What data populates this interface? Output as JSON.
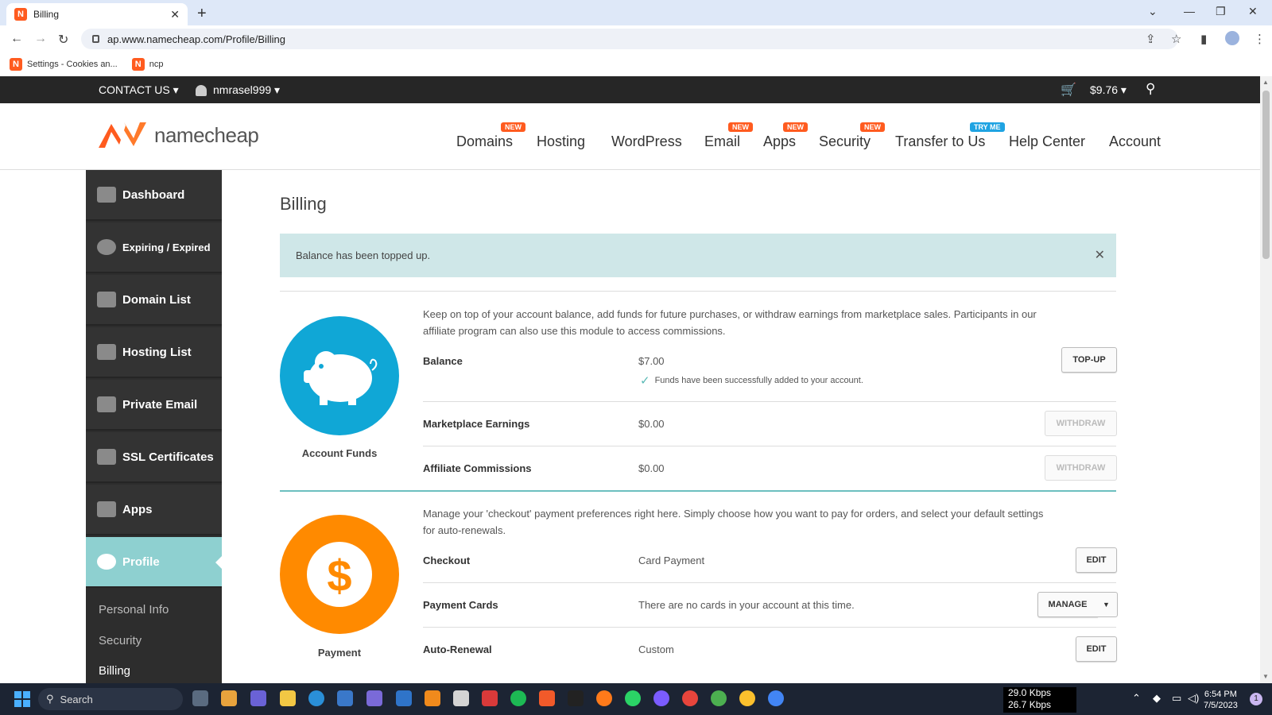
{
  "browser": {
    "tab_title": "Billing",
    "url": "ap.www.namecheap.com/Profile/Billing",
    "bookmarks": [
      {
        "label": "Settings - Cookies an..."
      },
      {
        "label": "ncp"
      }
    ]
  },
  "topbar": {
    "contact": "CONTACT US ▾",
    "username": "nmrasel999 ▾",
    "cart_total": "$9.76 ▾"
  },
  "header": {
    "logo_text": "namecheap",
    "nav": [
      {
        "label": "Domains",
        "badge": "NEW"
      },
      {
        "label": "Hosting",
        "badge": ""
      },
      {
        "label": "WordPress",
        "badge": ""
      },
      {
        "label": "Email",
        "badge": "NEW"
      },
      {
        "label": "Apps",
        "badge": "NEW"
      },
      {
        "label": "Security",
        "badge": "NEW"
      },
      {
        "label": "Transfer to Us",
        "badge": "TRY ME"
      },
      {
        "label": "Help Center",
        "badge": ""
      },
      {
        "label": "Account",
        "badge": ""
      }
    ]
  },
  "sidebar": {
    "items": [
      {
        "label": "Dashboard"
      },
      {
        "label": "Expiring / Expired"
      },
      {
        "label": "Domain List"
      },
      {
        "label": "Hosting List"
      },
      {
        "label": "Private Email"
      },
      {
        "label": "SSL Certificates"
      },
      {
        "label": "Apps"
      },
      {
        "label": "Profile"
      }
    ],
    "sub_items": [
      {
        "label": "Personal Info"
      },
      {
        "label": "Security"
      },
      {
        "label": "Billing"
      }
    ]
  },
  "main": {
    "title": "Billing",
    "alert": "Balance has been topped up.",
    "funds": {
      "label": "Account Funds",
      "intro": "Keep on top of your account balance, add funds for future purchases, or withdraw earnings from marketplace sales. Participants in our affiliate program can also use this module to access commissions.",
      "rows": [
        {
          "label": "Balance",
          "value": "$7.00",
          "note": "Funds have been successfully added to your account.",
          "button": "TOP-UP"
        },
        {
          "label": "Marketplace Earnings",
          "value": "$0.00",
          "button": "WITHDRAW"
        },
        {
          "label": "Affiliate Commissions",
          "value": "$0.00",
          "button": "WITHDRAW"
        }
      ]
    },
    "payment": {
      "label": "Payment",
      "intro": "Manage your 'checkout' payment preferences right here. Simply choose how you want to pay for orders, and select your default settings for auto-renewals.",
      "rows": [
        {
          "label": "Checkout",
          "value": "Card Payment",
          "button": "EDIT"
        },
        {
          "label": "Payment Cards",
          "value": "There are no cards in your account at this time.",
          "button": "MANAGE"
        },
        {
          "label": "Auto-Renewal",
          "value": "Custom",
          "button": "EDIT"
        }
      ]
    }
  },
  "taskbar": {
    "search": "Search",
    "net_down": "29.0 Kbps",
    "net_up": "26.7 Kbps",
    "time": "6:54 PM",
    "date": "7/5/2023",
    "notif": "1"
  },
  "colors": {
    "brand_orange": "#ff5b1f",
    "funds_circle": "#10a7d6",
    "payment_circle": "#ff8a00",
    "sidebar_active": "#8ed0d0",
    "alert_bg": "#cfe7e8"
  }
}
